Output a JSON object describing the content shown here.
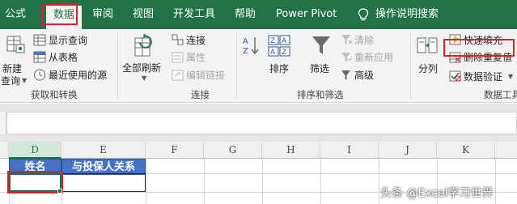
{
  "tabs": [
    {
      "label": "公式"
    },
    {
      "label": "数据"
    },
    {
      "label": "审阅"
    },
    {
      "label": "视图"
    },
    {
      "label": "开发工具"
    },
    {
      "label": "帮助"
    },
    {
      "label": "Power Pivot"
    },
    {
      "label": "操作说明搜索"
    }
  ],
  "ribbon": {
    "get_transform": {
      "label": "获取和转换",
      "new_query_line1": "新建",
      "new_query_line2": "查询",
      "show_queries": "显示查询",
      "from_table": "从表格",
      "recent_sources": "最近使用的源"
    },
    "connections": {
      "label": "连接",
      "refresh_all": "全部刷新",
      "connections": "连接",
      "properties": "属性",
      "edit_links": "编辑链接"
    },
    "sort_filter": {
      "label": "排序和筛选",
      "sort": "排序",
      "filter": "筛选",
      "clear": "清除",
      "reapply": "重新应用",
      "advanced": "高级"
    },
    "data_tools": {
      "label": "数据工具",
      "split_column": "分列",
      "flash_fill": "快速填充",
      "remove_duplicates": "删除重复值",
      "data_validation": "数据验证"
    }
  },
  "grid": {
    "columns": [
      "D",
      "E",
      "F",
      "G",
      "H",
      "I",
      "J",
      "K"
    ],
    "header_cells": [
      "姓名",
      "与投保人关系"
    ]
  },
  "watermark": "头条 @Excel学习世界",
  "colors": {
    "excel_green": "#217346",
    "highlight_red": "#d8232a",
    "header_blue": "#4472c4"
  }
}
